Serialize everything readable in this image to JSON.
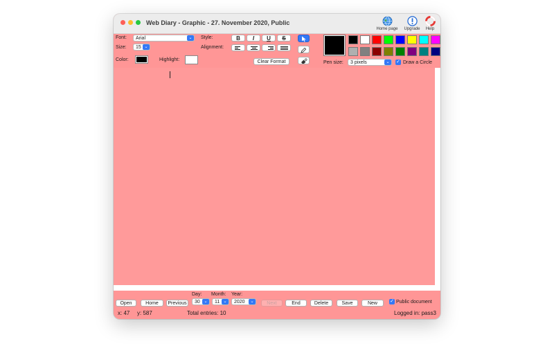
{
  "window": {
    "title": "Web Diary - Graphic - 27. November 2020, Public"
  },
  "toolbar": {
    "home_label": "Home page",
    "upgrade_label": "Upgrade",
    "help_label": "Help"
  },
  "format": {
    "font_label": "Font:",
    "font_value": "Arial",
    "size_label": "Size:",
    "size_value": "15",
    "style_label": "Style:",
    "bold": "B",
    "italic": "I",
    "underline": "U",
    "strike": "S",
    "alignment_label": "Alignment:",
    "color_label": "Color:",
    "color_value": "#000000",
    "highlight_label": "Highlight:",
    "highlight_value": "#ffffff",
    "clear_format_label": "Clear Format"
  },
  "tools": {
    "pointer": "pointer-tool",
    "pen": "pen-tool",
    "eraser": "eraser-tool"
  },
  "palette": {
    "current_color": "#000000",
    "row1": [
      "#000000",
      "#ffffff",
      "#ff0000",
      "#00ff00",
      "#0000ff",
      "#ffff00",
      "#00ffff",
      "#ff00ff"
    ],
    "row2": [
      "#b0b0b0",
      "#808080",
      "#8b0000",
      "#808000",
      "#008000",
      "#800080",
      "#008080",
      "#000080"
    ],
    "pen_size_label": "Pen size:",
    "pen_size_value": "3 pixels",
    "draw_circle_label": "Draw a Circle",
    "draw_circle_checked": true
  },
  "nav": {
    "open": "Open",
    "home": "Home",
    "previous": "Previous",
    "day_label": "Day:",
    "day_value": "30",
    "month_label": "Month:",
    "month_value": "11",
    "year_label": "Year:",
    "year_value": "2020",
    "next": "Next",
    "end": "End",
    "delete": "Delete",
    "save": "Save",
    "new": "New",
    "public_label": "Public document",
    "public_checked": true
  },
  "status": {
    "x": "x: 47",
    "y": "y: 587",
    "total": "Total entries: 10",
    "logged": "Logged in: pass3"
  }
}
